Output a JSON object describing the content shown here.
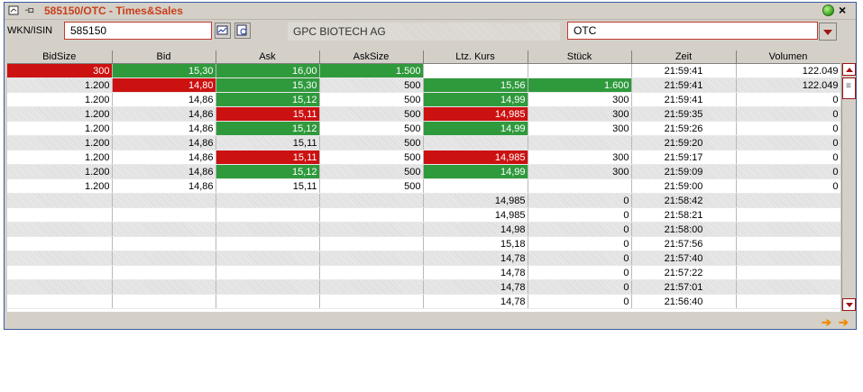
{
  "title": "585150/OTC - Times&Sales",
  "icons": {
    "window": "window-icon",
    "pin": "pin-icon",
    "status": "status-ball-icon",
    "close": "close-icon"
  },
  "toolbar": {
    "wkn_label": "WKN/ISIN",
    "wkn_value": "585150",
    "company": "GPC BIOTECH AG",
    "exchange": "OTC"
  },
  "columns": [
    "BidSize",
    "Bid",
    "Ask",
    "AskSize",
    "Ltz. Kurs",
    "Stück",
    "Zeit",
    "Volumen"
  ],
  "colors": {
    "red": "#cc1111",
    "green": "#2f9a3c",
    "title": "#c8401a"
  },
  "rows": [
    {
      "cells": [
        "300",
        "15,30",
        "16,00",
        "1.500",
        "",
        "",
        "21:59:41",
        "122.049"
      ],
      "hl": [
        "r",
        "g",
        "g",
        "g",
        "",
        "",
        "",
        ""
      ]
    },
    {
      "cells": [
        "1.200",
        "14,80",
        "15,30",
        "500",
        "15,56",
        "1.600",
        "21:59:41",
        "122.049"
      ],
      "hl": [
        "",
        "r",
        "g",
        "",
        "g",
        "g",
        "",
        ""
      ]
    },
    {
      "cells": [
        "1.200",
        "14,86",
        "15,12",
        "500",
        "14,99",
        "300",
        "21:59:41",
        "0"
      ],
      "hl": [
        "",
        "",
        "g",
        "",
        "g",
        "",
        "",
        ""
      ]
    },
    {
      "cells": [
        "1.200",
        "14,86",
        "15,11",
        "500",
        "14,985",
        "300",
        "21:59:35",
        "0"
      ],
      "hl": [
        "",
        "",
        "r",
        "",
        "r",
        "",
        "",
        ""
      ]
    },
    {
      "cells": [
        "1.200",
        "14,86",
        "15,12",
        "500",
        "14,99",
        "300",
        "21:59:26",
        "0"
      ],
      "hl": [
        "",
        "",
        "g",
        "",
        "g",
        "",
        "",
        ""
      ]
    },
    {
      "cells": [
        "1.200",
        "14,86",
        "15,11",
        "500",
        "",
        "",
        "21:59:20",
        "0"
      ],
      "hl": [
        "",
        "",
        "",
        "",
        "",
        "",
        "",
        ""
      ]
    },
    {
      "cells": [
        "1.200",
        "14,86",
        "15,11",
        "500",
        "14,985",
        "300",
        "21:59:17",
        "0"
      ],
      "hl": [
        "",
        "",
        "r",
        "",
        "r",
        "",
        "",
        ""
      ]
    },
    {
      "cells": [
        "1.200",
        "14,86",
        "15,12",
        "500",
        "14,99",
        "300",
        "21:59:09",
        "0"
      ],
      "hl": [
        "",
        "",
        "g",
        "",
        "g",
        "",
        "",
        ""
      ]
    },
    {
      "cells": [
        "1.200",
        "14,86",
        "15,11",
        "500",
        "",
        "",
        "21:59:00",
        "0"
      ],
      "hl": [
        "",
        "",
        "",
        "",
        "",
        "",
        "",
        ""
      ]
    },
    {
      "cells": [
        "",
        "",
        "",
        "",
        "14,985",
        "0",
        "21:58:42",
        ""
      ],
      "hl": [
        "",
        "",
        "",
        "",
        "",
        "",
        "",
        ""
      ]
    },
    {
      "cells": [
        "",
        "",
        "",
        "",
        "14,985",
        "0",
        "21:58:21",
        ""
      ],
      "hl": [
        "",
        "",
        "",
        "",
        "",
        "",
        "",
        ""
      ]
    },
    {
      "cells": [
        "",
        "",
        "",
        "",
        "14,98",
        "0",
        "21:58:00",
        ""
      ],
      "hl": [
        "",
        "",
        "",
        "",
        "",
        "",
        "",
        ""
      ]
    },
    {
      "cells": [
        "",
        "",
        "",
        "",
        "15,18",
        "0",
        "21:57:56",
        ""
      ],
      "hl": [
        "",
        "",
        "",
        "",
        "",
        "",
        "",
        ""
      ]
    },
    {
      "cells": [
        "",
        "",
        "",
        "",
        "14,78",
        "0",
        "21:57:40",
        ""
      ],
      "hl": [
        "",
        "",
        "",
        "",
        "",
        "",
        "",
        ""
      ]
    },
    {
      "cells": [
        "",
        "",
        "",
        "",
        "14,78",
        "0",
        "21:57:22",
        ""
      ],
      "hl": [
        "",
        "",
        "",
        "",
        "",
        "",
        "",
        ""
      ]
    },
    {
      "cells": [
        "",
        "",
        "",
        "",
        "14,78",
        "0",
        "21:57:01",
        ""
      ],
      "hl": [
        "",
        "",
        "",
        "",
        "",
        "",
        "",
        ""
      ]
    },
    {
      "cells": [
        "",
        "",
        "",
        "",
        "14,78",
        "0",
        "21:56:40",
        ""
      ],
      "hl": [
        "",
        "",
        "",
        "",
        "",
        "",
        "",
        ""
      ]
    }
  ]
}
